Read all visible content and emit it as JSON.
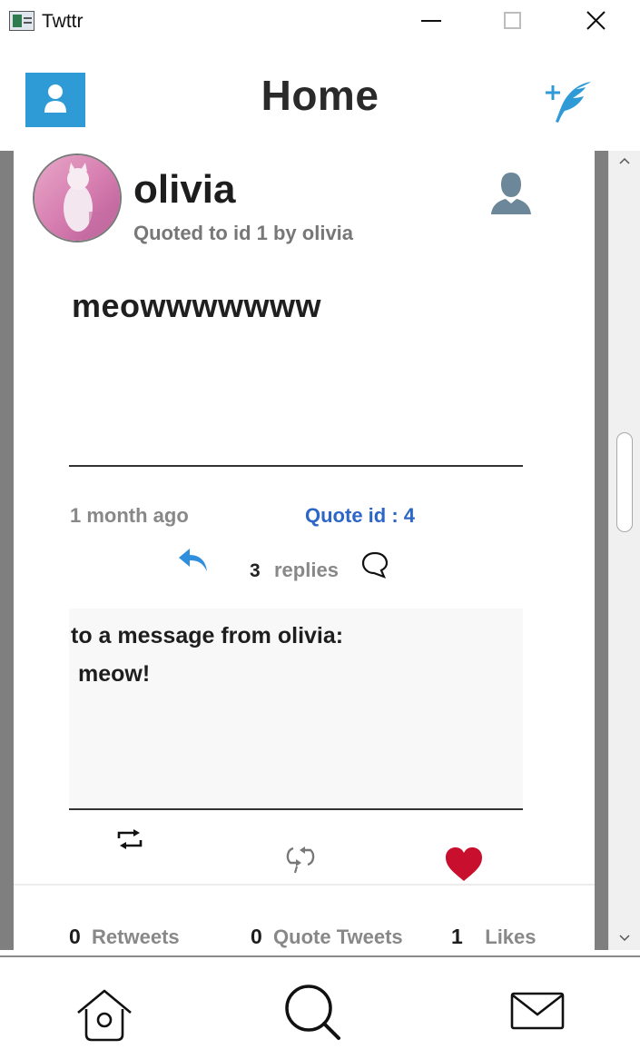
{
  "window": {
    "title": "Twttr"
  },
  "header": {
    "title": "Home"
  },
  "tweet": {
    "username": "olivia",
    "quoted_line": "Quoted to id 1 by olivia",
    "text": "meowwwwwww",
    "time_ago": "1 month ago",
    "quote_id": "Quote id : 4",
    "reply_count": "3",
    "replies_label": "replies",
    "quoted_message": {
      "header": "to a message from olivia:",
      "body": "meow!"
    },
    "stats": {
      "retweets_count": "0",
      "retweets_label": "Retweets",
      "quote_tweets_count": "0",
      "quote_tweets_label": "Quote Tweets",
      "likes_count": "1",
      "likes_label": "Likes"
    }
  },
  "colors": {
    "accent_blue": "#2f9bd6",
    "quote_id_blue": "#2c66c6",
    "like_red": "#c8102e",
    "muted_text": "#888888",
    "frame_gray": "#7f7f7f"
  },
  "icons": {
    "profile": "person-icon",
    "compose": "feather-plus-icon",
    "user_placeholder": "user-silhouette-icon",
    "reply": "reply-arrow-icon",
    "comment": "speech-bubble-icon",
    "retweet": "retweet-icon",
    "quote_tweet": "quote-retweet-icon",
    "like": "heart-icon",
    "home": "home-icon",
    "search": "search-icon",
    "messages": "envelope-icon"
  }
}
